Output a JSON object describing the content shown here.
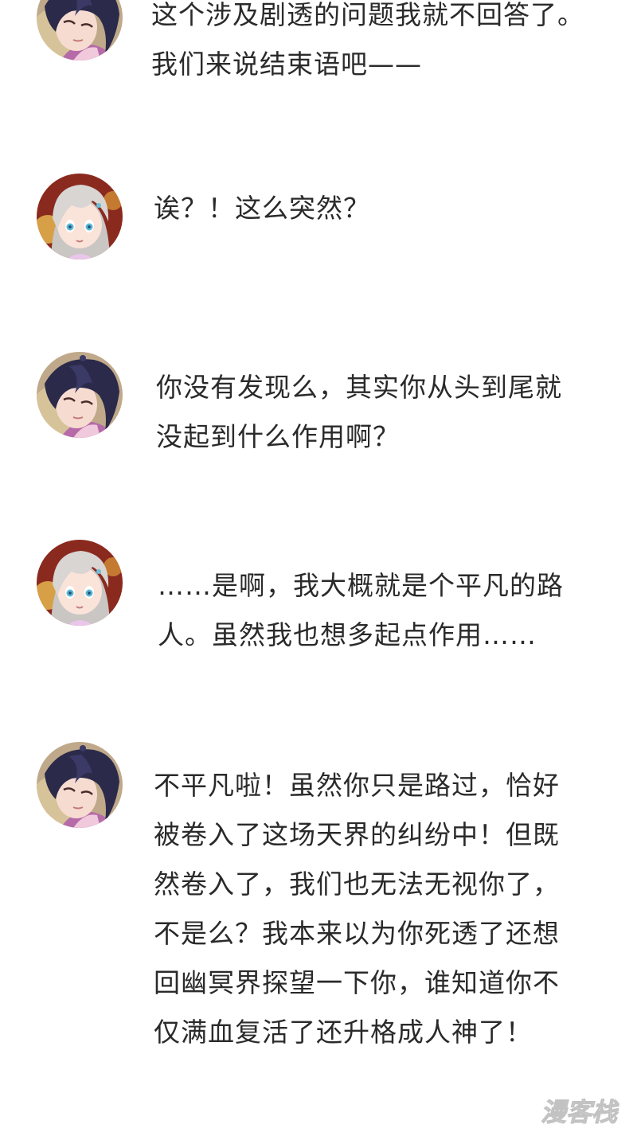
{
  "messages": [
    {
      "speaker": "boy",
      "lines": [
        "这个涉及剧透的问题我就不回答了。",
        "我们来说结束语吧——"
      ]
    },
    {
      "speaker": "girl",
      "lines": [
        "诶？！这么突然？"
      ]
    },
    {
      "speaker": "boy",
      "lines": [
        "你没有发现么，其实你从头到尾就",
        "没起到什么作用啊？"
      ]
    },
    {
      "speaker": "girl",
      "lines": [
        "……是啊，我大概就是个平凡的路",
        "人。虽然我也想多起点作用……"
      ]
    },
    {
      "speaker": "boy",
      "lines": [
        "不平凡啦！虽然你只是路过，恰好",
        "被卷入了这场天界的纠纷中！但既",
        "然卷入了，我们也无法无视你了，",
        "不是么？我本来以为你死透了还想",
        "回幽冥界探望一下你，谁知道你不",
        "仅满血复活了还升格成人神了！"
      ]
    }
  ],
  "watermark": {
    "text": "漫客栈",
    "color": "#d9d9d9"
  },
  "colors": {
    "text": "#2a2a2a",
    "boy_hair": "#2b2a4a",
    "girl_hair": "#c9c6c4",
    "skin": "#f6dcd0"
  }
}
